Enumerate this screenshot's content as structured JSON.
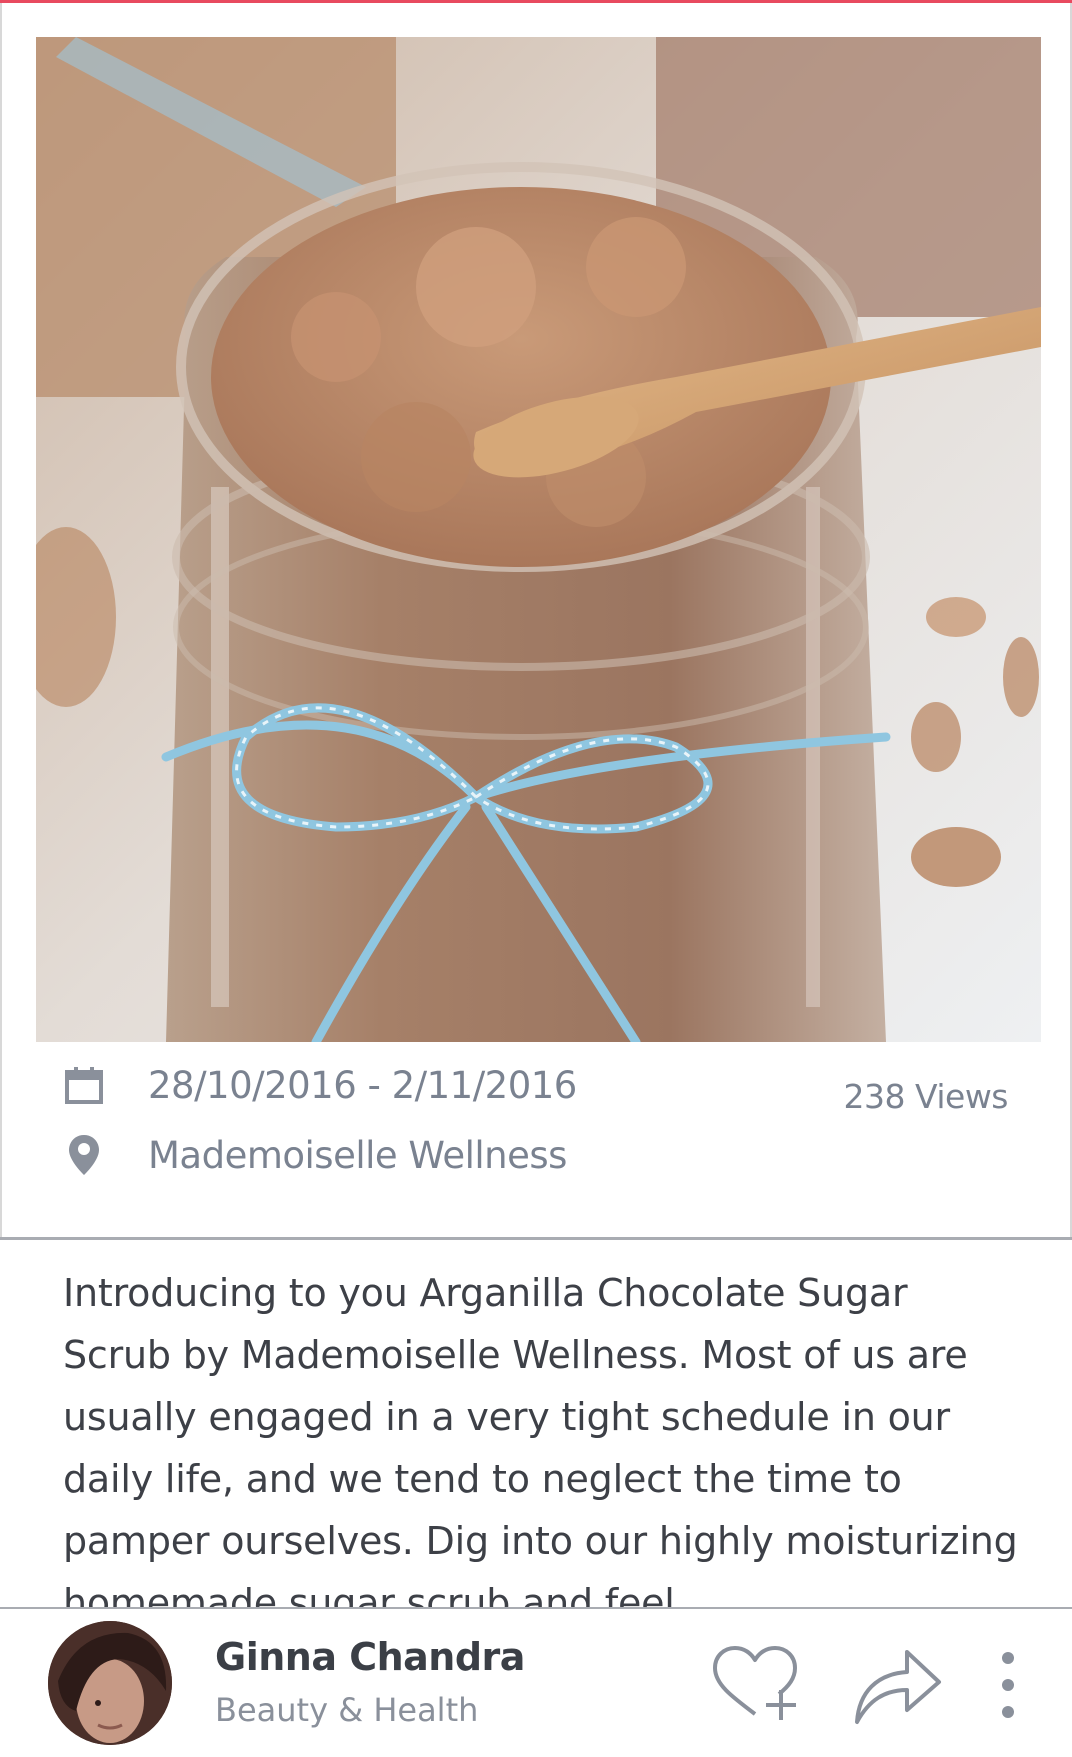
{
  "post": {
    "date_range": "28/10/2016 - 2/11/2016",
    "location": "Mademoiselle Wellness",
    "views": "238 Views",
    "description": "Introducing to you Arganilla Chocolate Sugar Scrub by Mademoiselle Wellness. Most of us are usually engaged in a very tight schedule in our daily life, and we tend to neglect the time to pamper ourselves. Dig into our highly moisturizing homemade sugar scrub and feel"
  },
  "author": {
    "name": "Ginna Chandra",
    "category": "Beauty & Health"
  },
  "icons": {
    "date": "calendar-icon",
    "location": "location-pin-icon",
    "like": "heart-plus-icon",
    "share": "share-arrow-icon",
    "more": "more-vertical-icon"
  },
  "colors": {
    "accent": "#e84a5f",
    "meta_text": "#7a8290",
    "body_text": "#3d4047",
    "icon_gray": "#8a909b"
  }
}
